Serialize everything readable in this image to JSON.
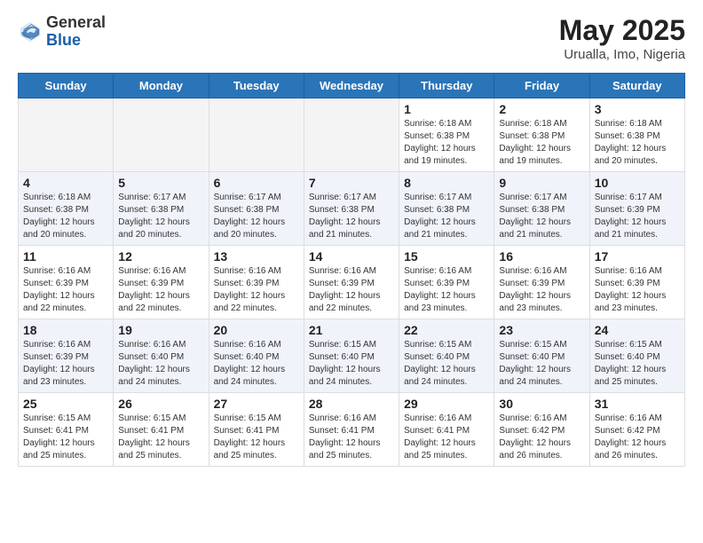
{
  "logo": {
    "general": "General",
    "blue": "Blue"
  },
  "title": {
    "month": "May 2025",
    "location": "Urualla, Imo, Nigeria"
  },
  "days_header": [
    "Sunday",
    "Monday",
    "Tuesday",
    "Wednesday",
    "Thursday",
    "Friday",
    "Saturday"
  ],
  "weeks": [
    [
      {
        "day": "",
        "empty": true
      },
      {
        "day": "",
        "empty": true
      },
      {
        "day": "",
        "empty": true
      },
      {
        "day": "",
        "empty": true
      },
      {
        "day": "1",
        "sunrise": "6:18 AM",
        "sunset": "6:38 PM",
        "daylight": "12 hours and 19 minutes."
      },
      {
        "day": "2",
        "sunrise": "6:18 AM",
        "sunset": "6:38 PM",
        "daylight": "12 hours and 19 minutes."
      },
      {
        "day": "3",
        "sunrise": "6:18 AM",
        "sunset": "6:38 PM",
        "daylight": "12 hours and 20 minutes."
      }
    ],
    [
      {
        "day": "4",
        "sunrise": "6:18 AM",
        "sunset": "6:38 PM",
        "daylight": "12 hours and 20 minutes."
      },
      {
        "day": "5",
        "sunrise": "6:17 AM",
        "sunset": "6:38 PM",
        "daylight": "12 hours and 20 minutes."
      },
      {
        "day": "6",
        "sunrise": "6:17 AM",
        "sunset": "6:38 PM",
        "daylight": "12 hours and 20 minutes."
      },
      {
        "day": "7",
        "sunrise": "6:17 AM",
        "sunset": "6:38 PM",
        "daylight": "12 hours and 21 minutes."
      },
      {
        "day": "8",
        "sunrise": "6:17 AM",
        "sunset": "6:38 PM",
        "daylight": "12 hours and 21 minutes."
      },
      {
        "day": "9",
        "sunrise": "6:17 AM",
        "sunset": "6:38 PM",
        "daylight": "12 hours and 21 minutes."
      },
      {
        "day": "10",
        "sunrise": "6:17 AM",
        "sunset": "6:39 PM",
        "daylight": "12 hours and 21 minutes."
      }
    ],
    [
      {
        "day": "11",
        "sunrise": "6:16 AM",
        "sunset": "6:39 PM",
        "daylight": "12 hours and 22 minutes."
      },
      {
        "day": "12",
        "sunrise": "6:16 AM",
        "sunset": "6:39 PM",
        "daylight": "12 hours and 22 minutes."
      },
      {
        "day": "13",
        "sunrise": "6:16 AM",
        "sunset": "6:39 PM",
        "daylight": "12 hours and 22 minutes."
      },
      {
        "day": "14",
        "sunrise": "6:16 AM",
        "sunset": "6:39 PM",
        "daylight": "12 hours and 22 minutes."
      },
      {
        "day": "15",
        "sunrise": "6:16 AM",
        "sunset": "6:39 PM",
        "daylight": "12 hours and 23 minutes."
      },
      {
        "day": "16",
        "sunrise": "6:16 AM",
        "sunset": "6:39 PM",
        "daylight": "12 hours and 23 minutes."
      },
      {
        "day": "17",
        "sunrise": "6:16 AM",
        "sunset": "6:39 PM",
        "daylight": "12 hours and 23 minutes."
      }
    ],
    [
      {
        "day": "18",
        "sunrise": "6:16 AM",
        "sunset": "6:39 PM",
        "daylight": "12 hours and 23 minutes."
      },
      {
        "day": "19",
        "sunrise": "6:16 AM",
        "sunset": "6:40 PM",
        "daylight": "12 hours and 24 minutes."
      },
      {
        "day": "20",
        "sunrise": "6:16 AM",
        "sunset": "6:40 PM",
        "daylight": "12 hours and 24 minutes."
      },
      {
        "day": "21",
        "sunrise": "6:15 AM",
        "sunset": "6:40 PM",
        "daylight": "12 hours and 24 minutes."
      },
      {
        "day": "22",
        "sunrise": "6:15 AM",
        "sunset": "6:40 PM",
        "daylight": "12 hours and 24 minutes."
      },
      {
        "day": "23",
        "sunrise": "6:15 AM",
        "sunset": "6:40 PM",
        "daylight": "12 hours and 24 minutes."
      },
      {
        "day": "24",
        "sunrise": "6:15 AM",
        "sunset": "6:40 PM",
        "daylight": "12 hours and 25 minutes."
      }
    ],
    [
      {
        "day": "25",
        "sunrise": "6:15 AM",
        "sunset": "6:41 PM",
        "daylight": "12 hours and 25 minutes."
      },
      {
        "day": "26",
        "sunrise": "6:15 AM",
        "sunset": "6:41 PM",
        "daylight": "12 hours and 25 minutes."
      },
      {
        "day": "27",
        "sunrise": "6:15 AM",
        "sunset": "6:41 PM",
        "daylight": "12 hours and 25 minutes."
      },
      {
        "day": "28",
        "sunrise": "6:16 AM",
        "sunset": "6:41 PM",
        "daylight": "12 hours and 25 minutes."
      },
      {
        "day": "29",
        "sunrise": "6:16 AM",
        "sunset": "6:41 PM",
        "daylight": "12 hours and 25 minutes."
      },
      {
        "day": "30",
        "sunrise": "6:16 AM",
        "sunset": "6:42 PM",
        "daylight": "12 hours and 26 minutes."
      },
      {
        "day": "31",
        "sunrise": "6:16 AM",
        "sunset": "6:42 PM",
        "daylight": "12 hours and 26 minutes."
      }
    ]
  ],
  "labels": {
    "sunrise": "Sunrise:",
    "sunset": "Sunset:",
    "daylight": "Daylight:"
  }
}
